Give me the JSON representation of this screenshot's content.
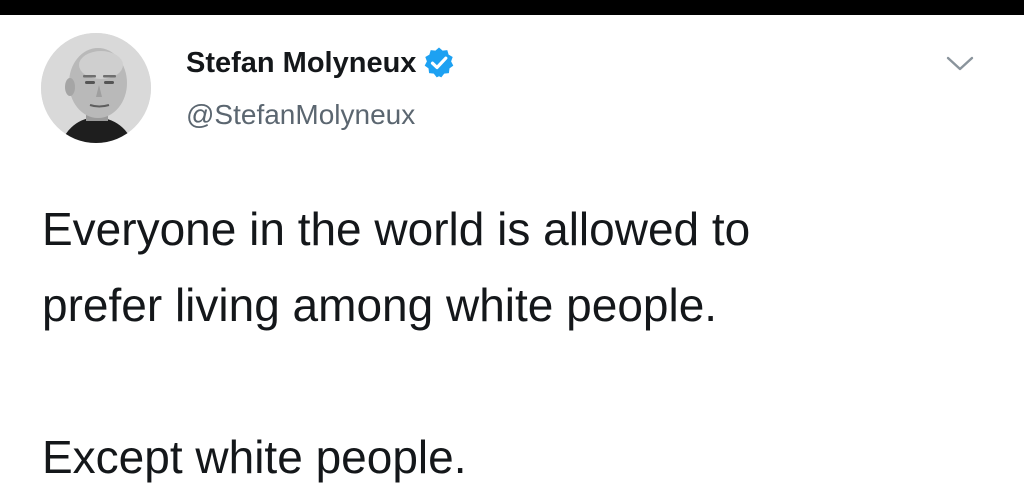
{
  "author": {
    "display_name": "Stefan Molyneux",
    "handle": "@StefanMolyneux",
    "verified": true,
    "verified_icon": "verified-badge-icon",
    "verified_color": "#1da1f2"
  },
  "menu": {
    "icon": "chevron-down-icon"
  },
  "tweet": {
    "line_1": "Everyone in the world is allowed to",
    "line_2": "prefer living among white people.",
    "line_3": "Except white people."
  },
  "colors": {
    "text": "#14171a",
    "secondary_text": "#5b6670",
    "background": "#ffffff",
    "frame": "#000000"
  }
}
